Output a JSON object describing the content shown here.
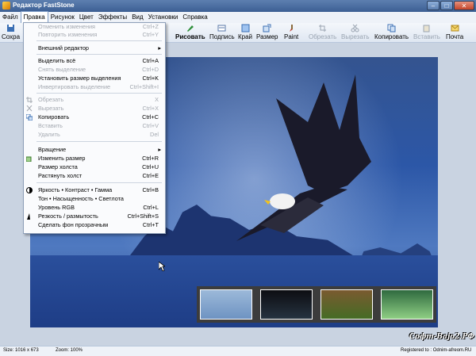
{
  "window": {
    "title": "Редактор FastStone",
    "minimize": "–",
    "maximize": "□",
    "close": "✕"
  },
  "menubar": {
    "items": [
      "Файл",
      "Правка",
      "Рисунок",
      "Цвет",
      "Эффекты",
      "Вид",
      "Установки",
      "Справка"
    ],
    "active": "Правка"
  },
  "toolbar": {
    "left_cut": "Сохра",
    "buttons": [
      {
        "label": "Рисовать",
        "icon": "pencil-icon",
        "bold": true
      },
      {
        "label": "Подпись",
        "icon": "caption-icon"
      },
      {
        "label": "Край",
        "icon": "border-icon"
      },
      {
        "label": "Размер",
        "icon": "resize-icon"
      },
      {
        "label": "Paint",
        "icon": "paint-brush-icon"
      },
      {
        "label": "Обрезать",
        "icon": "crop-icon",
        "disabled": true
      },
      {
        "label": "Вырезать",
        "icon": "scissors-icon",
        "disabled": true
      },
      {
        "label": "Копировать",
        "icon": "copy-icon"
      },
      {
        "label": "Вставить",
        "icon": "paste-icon",
        "disabled": true
      },
      {
        "label": "Почта",
        "icon": "mail-icon"
      }
    ]
  },
  "edit_menu": {
    "undo": {
      "label": "Отменить изменения",
      "shortcut": "Ctrl+Z",
      "disabled": true
    },
    "redo": {
      "label": "Повторить изменения",
      "shortcut": "Ctrl+Y",
      "disabled": true
    },
    "external_editor": {
      "label": "Внешний редактор"
    },
    "select_all": {
      "label": "Выделить всё",
      "shortcut": "Ctrl+A"
    },
    "deselect": {
      "label": "Снять выделение",
      "shortcut": "Ctrl+D",
      "disabled": true
    },
    "set_selection_size": {
      "label": "Установить размер выделения",
      "shortcut": "Ctrl+K"
    },
    "invert_selection": {
      "label": "Инвертировать выделение",
      "shortcut": "Ctrl+Shift+I",
      "disabled": true
    },
    "crop": {
      "label": "Обрезать",
      "shortcut": "X",
      "disabled": true
    },
    "cut": {
      "label": "Вырезать",
      "shortcut": "Ctrl+X",
      "disabled": true
    },
    "copy": {
      "label": "Копировать",
      "shortcut": "Ctrl+C"
    },
    "paste": {
      "label": "Вставить",
      "shortcut": "Ctrl+V",
      "disabled": true
    },
    "delete": {
      "label": "Удалить",
      "shortcut": "Del",
      "disabled": true
    },
    "rotate": {
      "label": "Вращение"
    },
    "resize": {
      "label": "Изменить размер",
      "shortcut": "Ctrl+R"
    },
    "canvas_size": {
      "label": "Размер холста",
      "shortcut": "Ctrl+U"
    },
    "stretch_canvas": {
      "label": "Растянуть холст",
      "shortcut": "Ctrl+E"
    },
    "brightness": {
      "label": "Яркость • Контраст • Гамма",
      "shortcut": "Ctrl+B"
    },
    "hue": {
      "label": "Тон • Насыщенность • Светлота"
    },
    "rgb": {
      "label": "Уровень RGB",
      "shortcut": "Ctrl+L"
    },
    "sharpen": {
      "label": "Резкость / размытость",
      "shortcut": "Ctrl+Shift+S"
    },
    "transparent": {
      "label": "Сделать фон прозрачным",
      "shortcut": "Ctrl+T"
    }
  },
  "status": {
    "size": "Size: 1016 x 673",
    "zoom": "Zoom: 100%",
    "registered": "Registered to : Odnim-afreom.RU"
  },
  "watermark": "Софт-Ваjo2.РФ",
  "colors": {
    "accent": "#3c5f93",
    "menu_bg": "#fafbfd"
  }
}
